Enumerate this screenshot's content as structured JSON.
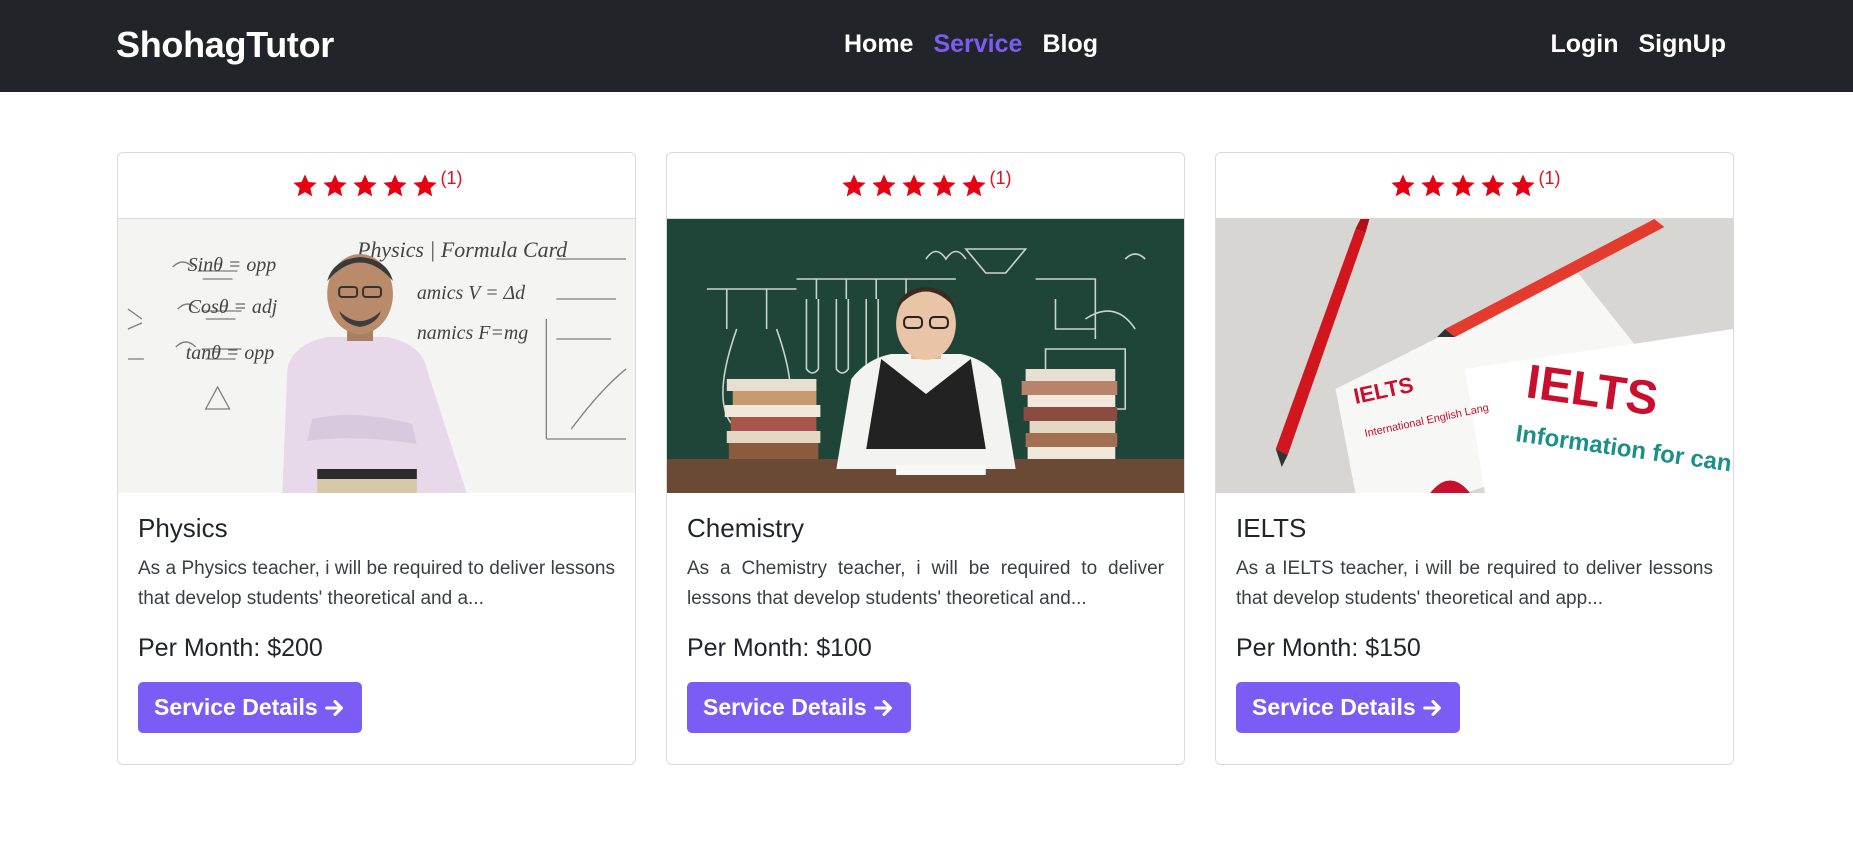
{
  "colors": {
    "accent": "#7b5cf5",
    "navbar": "#212529",
    "star": "#e60012"
  },
  "navbar": {
    "brand": "ShohagTutor",
    "links": [
      {
        "label": "Home",
        "active": false
      },
      {
        "label": "Service",
        "active": true
      },
      {
        "label": "Blog",
        "active": false
      }
    ],
    "auth": [
      {
        "label": "Login"
      },
      {
        "label": "SignUp"
      }
    ]
  },
  "services": [
    {
      "title": "Physics",
      "rating_stars": 5,
      "rating_count": "(1)",
      "image_icon": "physics-teacher-whiteboard-image",
      "description": "As a Physics teacher, i will be required to deliver lessons that develop students' theoretical and a...",
      "price": "Per Month: $200",
      "button": "Service Details",
      "button_icon": "arrow-right-icon"
    },
    {
      "title": "Chemistry",
      "rating_stars": 5,
      "rating_count": "(1)",
      "image_icon": "chemistry-teacher-books-image",
      "description": "As a Chemistry teacher, i will be required to deliver lessons that develop students' theoretical and...",
      "price": "Per Month: $100",
      "button": "Service Details",
      "button_icon": "arrow-right-icon"
    },
    {
      "title": "IELTS",
      "rating_stars": 5,
      "rating_count": "(1)",
      "image_icon": "ielts-booklets-pens-image",
      "description": "As a IELTS teacher, i will be required to deliver lessons that develop students' theoretical and app...",
      "price": "Per Month: $150",
      "button": "Service Details",
      "button_icon": "arrow-right-icon"
    }
  ],
  "images": {
    "physics": {
      "formula_card": "Physics | Formula Card"
    },
    "ielts": {
      "logo": "IELTS",
      "small_text": "International English Lang",
      "info": "Information for can"
    }
  }
}
